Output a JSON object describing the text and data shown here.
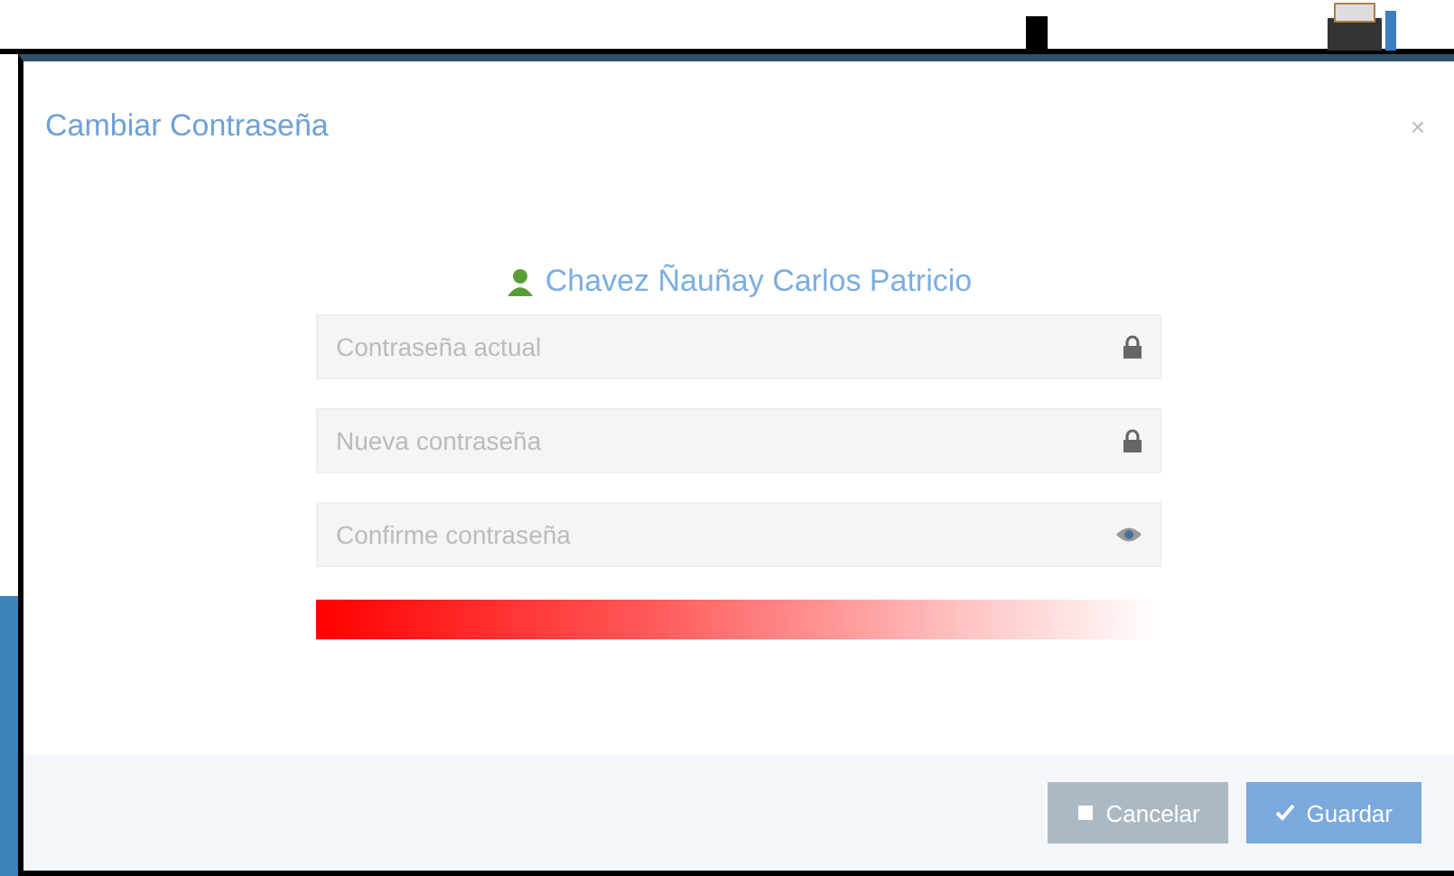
{
  "modal": {
    "title": "Cambiar Contraseña",
    "close": "×",
    "user": "Chavez Ñauñay Carlos Patricio",
    "fields": [
      {
        "placeholder": "Contraseña actual",
        "kind": "lock"
      },
      {
        "placeholder": "Nueva contraseña",
        "kind": "lock"
      },
      {
        "placeholder": "Confirme contraseña",
        "kind": "eye"
      }
    ],
    "buttons": [
      {
        "label": "Cancelar",
        "kind": "cancel"
      },
      {
        "label": "Guardar",
        "kind": "save"
      }
    ]
  }
}
